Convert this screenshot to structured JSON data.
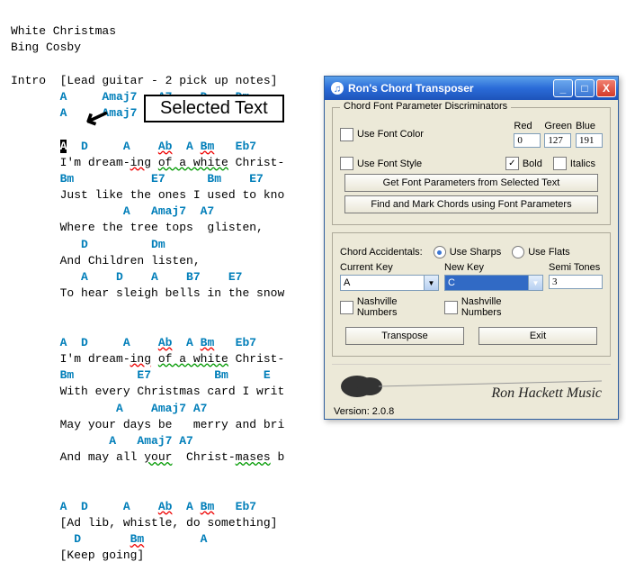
{
  "song": {
    "title": "White Christmas",
    "artist": "Bing Cosby",
    "intro_label": "Intro",
    "intro_note": "[Lead guitar - 2 pick up notes]",
    "lines": [
      {
        "chords": "A     Amaj7   A7    D    Dm",
        "lyric": ""
      },
      {
        "chords": "A     Amaj7   D    E7",
        "lyric": ""
      },
      {
        "chords": "",
        "lyric": ""
      },
      {
        "chords": "A  D     A    Ab  A Bm   Eb7",
        "lyric": "I'm dream-ing of a white Christ-",
        "sel": true
      },
      {
        "chords": "Bm           E7      Bm    E7",
        "lyric": "Just like the ones I used to kno"
      },
      {
        "chords": "         A   Amaj7  A7",
        "lyric": "Where the tree tops  glisten,"
      },
      {
        "chords": "   D         Dm",
        "lyric": "And Children listen,"
      },
      {
        "chords": "   A    D    A    B7    E7",
        "lyric": "To hear sleigh bells in the snow"
      },
      {
        "chords": "",
        "lyric": ""
      },
      {
        "chords": "A  D     A    Ab  A Bm   Eb7",
        "lyric": "I'm dream-ing of a white Christ-"
      },
      {
        "chords": "Bm         E7         Bm     E",
        "lyric": "With every Christmas card I writ"
      },
      {
        "chords": "        A    Amaj7 A7",
        "lyric": "May your days be   merry and bri"
      },
      {
        "chords": "       A   Amaj7 A7",
        "lyric": "And may all your  Christ-mases b"
      },
      {
        "chords": "",
        "lyric": ""
      },
      {
        "chords": "A  D     A    Ab  A Bm   Eb7",
        "lyric": "[Ad lib, whistle, do something]"
      },
      {
        "chords": "  D       Bm        A",
        "lyric": "[Keep going]"
      }
    ]
  },
  "callout": "Selected Text",
  "win": {
    "title": "Ron's Chord Transposer",
    "group1_title": "Chord Font Parameter Discriminators",
    "use_font_color": "Use Font Color",
    "red_lbl": "Red",
    "green_lbl": "Green",
    "blue_lbl": "Blue",
    "red": "0",
    "green": "127",
    "blue": "191",
    "use_font_style": "Use Font Style",
    "bold": "Bold",
    "italics": "Italics",
    "btn_get": "Get Font Parameters from Selected Text",
    "btn_find": "Find and Mark Chords using Font Parameters",
    "accidentals": "Chord Accidentals:",
    "use_sharps": "Use Sharps",
    "use_flats": "Use Flats",
    "current_key_lbl": "Current Key",
    "new_key_lbl": "New Key",
    "semi_lbl": "Semi Tones",
    "current_key": "A",
    "new_key": "C",
    "semi": "3",
    "nash1": "Nashville Numbers",
    "nash2": "Nashville Numbers",
    "transpose": "Transpose",
    "exit": "Exit",
    "brand": "Ron Hackett Music",
    "version": "Version: 2.0.8"
  }
}
